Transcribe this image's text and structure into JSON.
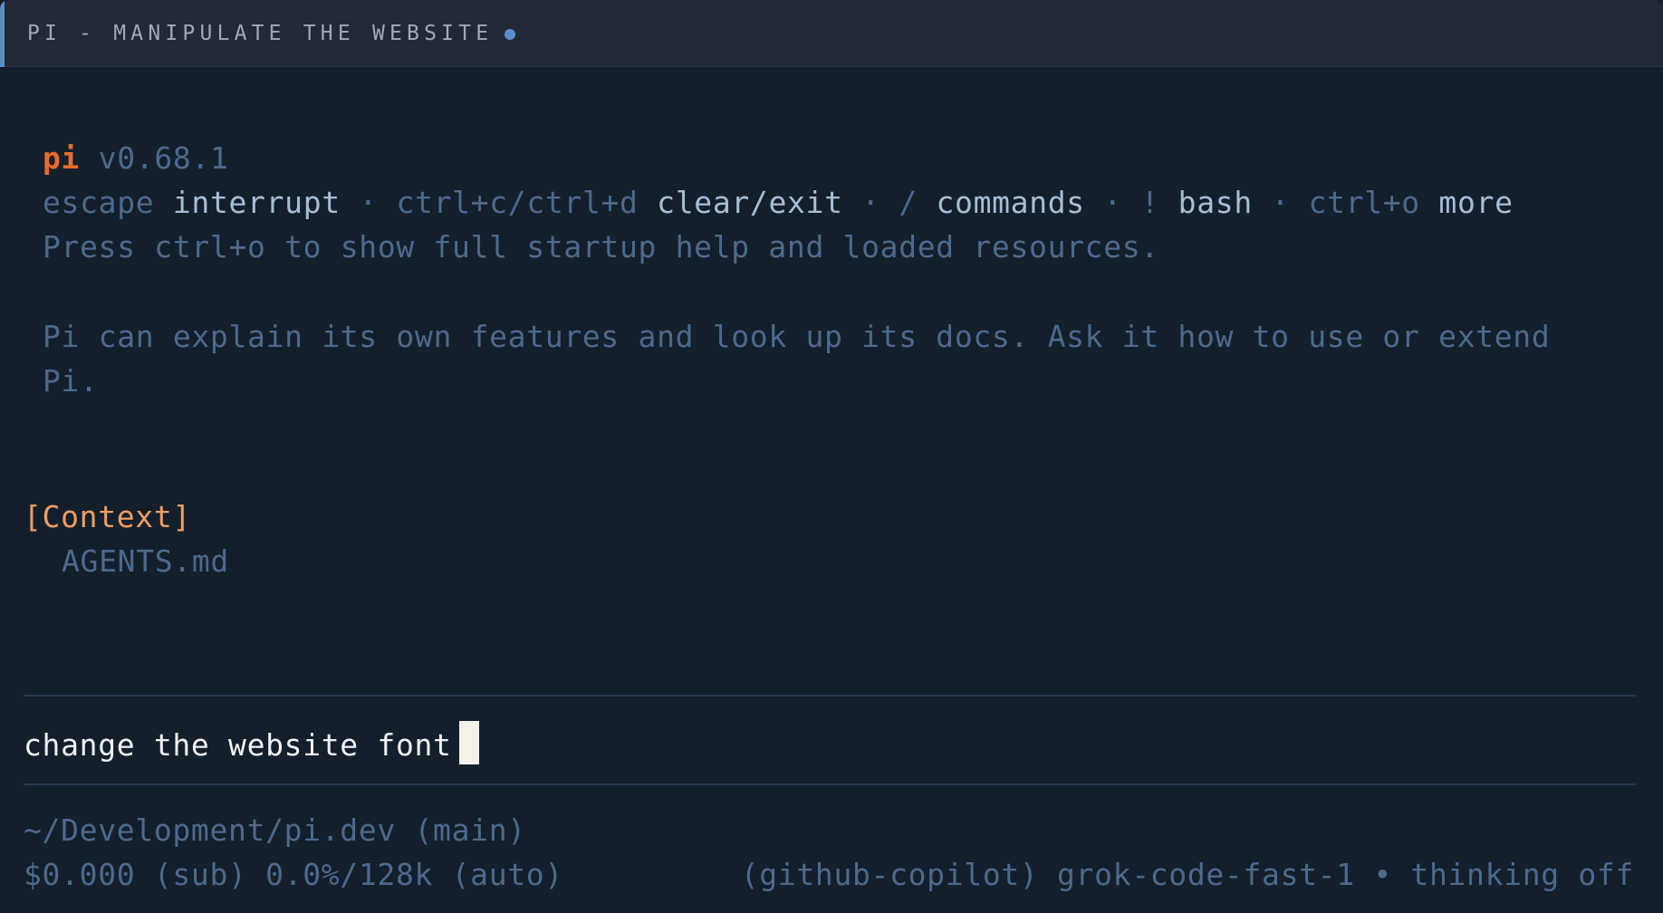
{
  "window": {
    "title": "PI - MANIPULATE THE WEBSITE"
  },
  "header": {
    "app_name": "pi",
    "version": "v0.68.1"
  },
  "shortcuts": [
    {
      "key": "escape",
      "action": "interrupt"
    },
    {
      "key": "ctrl+c/ctrl+d",
      "action": "clear/exit"
    },
    {
      "key": "/",
      "action": "commands"
    },
    {
      "key": "!",
      "action": "bash"
    },
    {
      "key": "ctrl+o",
      "action": "more"
    }
  ],
  "separator": "·",
  "help_text": "Press ctrl+o to show full startup help and loaded resources.",
  "intro": {
    "line1": "Pi can explain its own features and look up its docs. Ask it how to use or extend",
    "line2": "Pi."
  },
  "context": {
    "label": "[Context]",
    "files": [
      "AGENTS.md"
    ]
  },
  "input": {
    "value": "change the website font"
  },
  "footer": {
    "path": "~/Development/pi.dev (main)",
    "usage": "$0.000 (sub) 0.0%/128k (auto)",
    "model": "(github-copilot) grok-code-fast-1 • thinking off"
  },
  "colors": {
    "background": "#141f2c",
    "titlebar": "#212836",
    "accent": "#eb6a2c",
    "context": "#ee9e62",
    "dim_text": "#4d6a8d",
    "bright_text": "#a7bed6"
  }
}
